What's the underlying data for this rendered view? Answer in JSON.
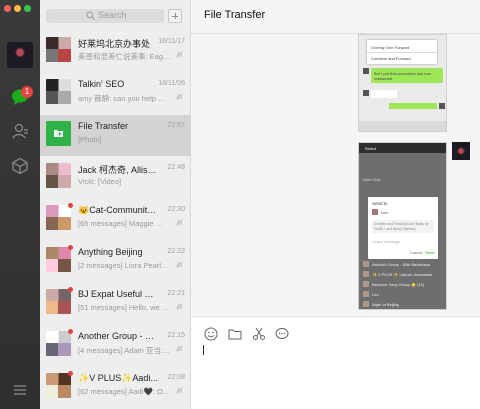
{
  "window": {
    "title": "File Transfer"
  },
  "rail": {
    "badge_count": "1"
  },
  "search": {
    "placeholder": "Search"
  },
  "chats": [
    {
      "name": "好莱坞北京办事处",
      "time": "18/11/17",
      "preview": "美恩和显美仁说美事: Eagle...",
      "muted": true,
      "unread_dot": false
    },
    {
      "name": "Talkin' SEO",
      "time": "18/11/06",
      "preview": "amy 薛静: can you help me ma...",
      "muted": true,
      "unread_dot": false
    },
    {
      "name": "File Transfer",
      "time": "22:57",
      "preview": "[Photo]",
      "muted": false,
      "unread_dot": false,
      "active": true
    },
    {
      "name": "Jack 柯杰奇, Alliso...",
      "time": "22:48",
      "preview": "Vicki: [Video]",
      "muted": false,
      "unread_dot": false
    },
    {
      "name": "🐱Cat-Community...",
      "time": "22:30",
      "preview": "[65 messages] Maggie 🐈...",
      "muted": true,
      "unread_dot": true
    },
    {
      "name": "Anything Beijing",
      "time": "22:22",
      "preview": "[2 messages] Liora Pearlm...",
      "muted": true,
      "unread_dot": true
    },
    {
      "name": "BJ Expat Useful Con...",
      "time": "22:21",
      "preview": "[51 messages] Hello, we ar...",
      "muted": true,
      "unread_dot": true
    },
    {
      "name": "Another Group - 30t...",
      "time": "22:15",
      "preview": "[4 messages] Adam 亚当:...",
      "muted": true,
      "unread_dot": true
    },
    {
      "name": "✨V PLUS✨Aadi...",
      "time": "22:08",
      "preview": "[62 messages] Aadi🖤: O...",
      "muted": true,
      "unread_dot": true
    }
  ],
  "photo1": {
    "menu": [
      "Overlay One Forward",
      "Combine and Forward"
    ],
    "bubble_text": "But I put that promotion into non restaurant"
  },
  "photo2": {
    "header": "Select",
    "new_chat": "New Chat",
    "dialog_title": "Send to",
    "dialog_user": "Leo",
    "dialog_body": "Combine and Forward(Chat History for You98 + and Nancy Stephen)",
    "dialog_placeholder": "Leave message",
    "cancel_label": "Cancel",
    "send_label": "Send",
    "list": [
      "Aiwinchi Group - 30th Bauwhaus",
      "✨ V PLUS ✨ Launch Innovation",
      "Beyonce Yang Group 🌟 (12)",
      "Leo",
      "Night of Beijing"
    ]
  },
  "colors": {
    "accent": "#1aad19",
    "badge": "#e64340",
    "rail": "#323233"
  },
  "icons": [
    "chat-icon",
    "contacts-icon",
    "mini-program-icon",
    "menu-icon",
    "emoji-icon",
    "folder-icon",
    "scissors-icon",
    "bubble-icon"
  ]
}
